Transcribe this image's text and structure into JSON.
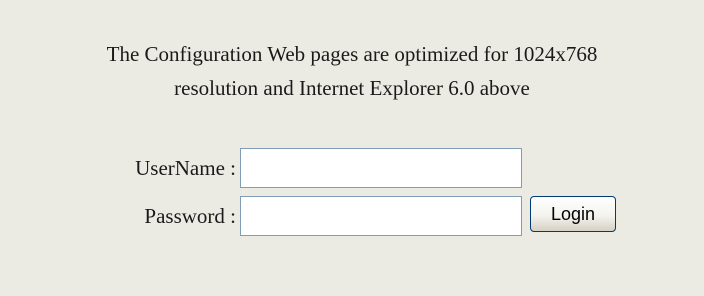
{
  "notice": {
    "line1": "The Configuration Web pages are optimized for 1024x768",
    "line2": "resolution and Internet Explorer 6.0 above"
  },
  "login_form": {
    "username_label": "UserName :",
    "username_value": "",
    "password_label": "Password :",
    "password_value": "",
    "login_label": "Login"
  },
  "colors": {
    "background": "#ecebe3",
    "input_border": "#7f9db9",
    "button_border": "#003c74"
  }
}
